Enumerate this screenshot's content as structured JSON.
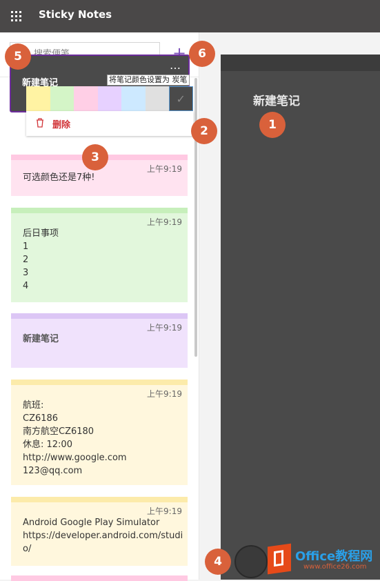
{
  "app": {
    "title": "Sticky Notes"
  },
  "search": {
    "placeholder": "搜索便笺"
  },
  "active_note": {
    "title": "新建笔记",
    "menu": "…"
  },
  "tooltip": "将笔记颜色设置为 炭笔",
  "palette": {
    "colors": [
      "#fff3a3",
      "#d4f5c7",
      "#ffcfe6",
      "#e7d1ff",
      "#cde9ff",
      "#e0e0e0",
      "#4a4a4a"
    ],
    "selected": "charcoal",
    "check": "✓"
  },
  "context_menu": {
    "delete_label": "删除"
  },
  "notes": [
    {
      "time": "上午9:19",
      "body": "可选颜色还是7种!",
      "color": "#ffe3f0",
      "strip": "#ffc9e2"
    },
    {
      "time": "上午9:19",
      "body": "后日事项\n1\n2\n3\n4",
      "color": "#e2f7dc",
      "strip": "#c7efbb"
    },
    {
      "time": "上午9:19",
      "body": "新建笔记",
      "color": "#f0e2fc",
      "strip": "#dcc6f5"
    },
    {
      "time": "上午9:19",
      "body": "航班:\nCZ6186\n南方航空CZ6180\n休息: 12:00\nhttp://www.google.com\n123@qq.com",
      "color": "#fff7dd",
      "strip": "#fcebaa"
    },
    {
      "time": "上午9:19",
      "body": "Android Google Play Simulator\nhttps://developer.android.com/studio/",
      "color": "#fff7dd",
      "strip": "#fcebaa"
    }
  ],
  "detail": {
    "title": "新建笔记"
  },
  "badges": [
    "1",
    "2",
    "3",
    "4",
    "5",
    "6"
  ],
  "branding": {
    "name": "Office教程网",
    "url": "www.office26.com"
  },
  "colors": {
    "titlebar": "#4a4848",
    "accent": "#7b4fb8",
    "badge": "#d9613b",
    "delete": "#d13438"
  }
}
